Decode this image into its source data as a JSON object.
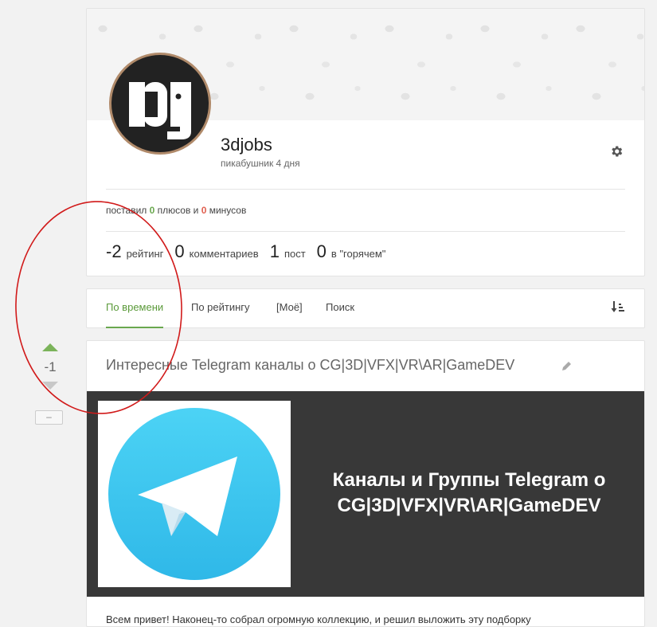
{
  "profile": {
    "username": "3djobs",
    "since": "пикабушник 4 дня",
    "votes": {
      "prefix": "поставил ",
      "plus_count": "0",
      "plus_label": " плюсов и ",
      "minus_count": "0",
      "minus_label": " минусов"
    },
    "stats": [
      {
        "value": "-2",
        "label": "рейтинг"
      },
      {
        "value": "0",
        "label": "комментариев"
      },
      {
        "value": "1",
        "label": "пост"
      },
      {
        "value": "0",
        "label": "в \"горячем\""
      }
    ]
  },
  "tabs": [
    {
      "label": "По времени",
      "active": true
    },
    {
      "label": "По рейтингу"
    },
    {
      "label": "[Моё]"
    },
    {
      "label": "Поиск"
    }
  ],
  "story": {
    "rating": "-1",
    "collapse_label": "–",
    "title": "Интересные Telegram каналы  о CG|3D|VFX|VR\\AR|GameDEV",
    "banner_line1": "Каналы и Группы Telegram о",
    "banner_line2": "CG|3D|VFX|VR\\AR|GameDEV",
    "text": "Всем привет! Наконец-то собрал огромную коллекцию, и решил выложить эту подборку"
  },
  "icons": {
    "settings": "gear-icon",
    "sort": "sort-icon",
    "edit": "pencil-icon",
    "brand": "telegram-logo"
  },
  "colors": {
    "accent_green": "#6aa84f",
    "minus_red": "#e06050",
    "banner_bg": "#383838",
    "telegram_blue": "#3fc4ee",
    "annotation_red": "#d11a1a"
  }
}
